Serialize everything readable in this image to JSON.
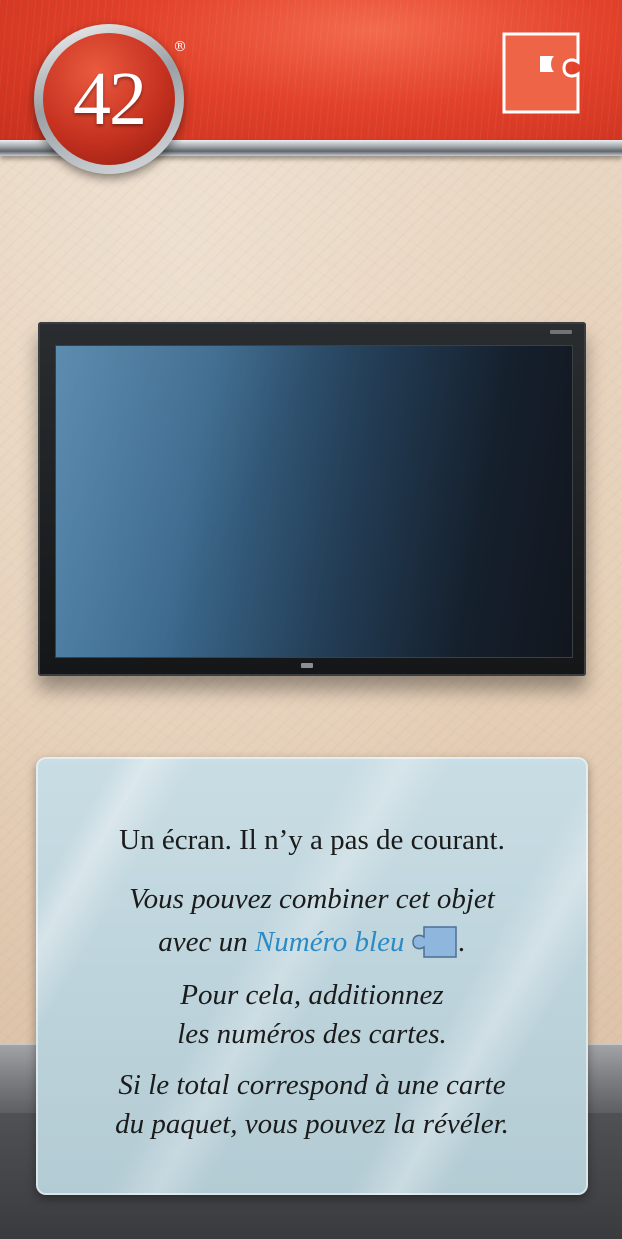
{
  "card": {
    "number": "42",
    "number_mark": "®",
    "description": "Un écran. Il n’y a pas de courant.",
    "combine_line1": "Vous pouvez combiner cet objet",
    "combine_prefix": "avec un ",
    "combine_highlight": "Numéro bleu",
    "combine_suffix": ".",
    "rule_line1": "Pour cela, additionnez",
    "rule_line2": "les numéros des cartes.",
    "reveal_line1": "Si le total correspond à une carte",
    "reveal_line2": "du paquet, vous pouvez la révéler."
  },
  "icons": {
    "header": "red-puzzle-piece-icon",
    "inline": "blue-puzzle-piece-icon"
  },
  "colors": {
    "banner": "#e2412a",
    "highlight_blue": "#2a8bc6",
    "panel": "#c9dde4"
  }
}
